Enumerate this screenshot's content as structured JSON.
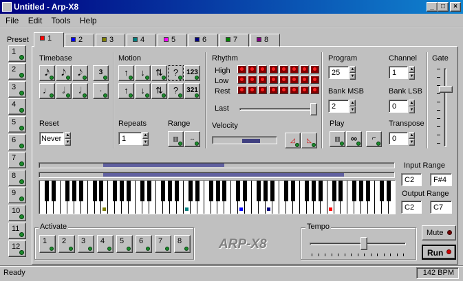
{
  "window": {
    "title": "Untitled - Arp-X8"
  },
  "menu": [
    "File",
    "Edit",
    "Tools",
    "Help"
  ],
  "preset": {
    "label": "Preset",
    "buttons": [
      "1",
      "2",
      "3",
      "4",
      "5",
      "6",
      "7",
      "8",
      "9",
      "10",
      "11",
      "12"
    ]
  },
  "tabs": [
    {
      "label": "1",
      "color": "#ff0000"
    },
    {
      "label": "2",
      "color": "#0000ff"
    },
    {
      "label": "3",
      "color": "#808000"
    },
    {
      "label": "4",
      "color": "#008080"
    },
    {
      "label": "5",
      "color": "#ff00ff"
    },
    {
      "label": "6",
      "color": "#000080"
    },
    {
      "label": "7",
      "color": "#008000"
    },
    {
      "label": "8",
      "color": "#800080"
    }
  ],
  "timebase": {
    "label": "Timebase",
    "b1": "3",
    "b2": "·"
  },
  "motion": {
    "label": "Motion",
    "up": "↑",
    "down": "↓",
    "updown": "⇅",
    "random": "?",
    "order1": "123",
    "order2": "321"
  },
  "reset": {
    "label": "Reset",
    "value": "Never"
  },
  "repeats": {
    "label": "Repeats",
    "value": "1"
  },
  "range": {
    "label": "Range"
  },
  "rhythm": {
    "label": "Rhythm",
    "rows": [
      "High",
      "Low",
      "Rest"
    ],
    "last_label": "Last"
  },
  "velocity": {
    "label": "Velocity",
    "level": 0.45
  },
  "program": {
    "label": "Program",
    "value": "25"
  },
  "channel": {
    "label": "Channel",
    "value": "1"
  },
  "bank_msb": {
    "label": "Bank MSB",
    "value": "2"
  },
  "bank_lsb": {
    "label": "Bank LSB",
    "value": "0"
  },
  "play": {
    "label": "Play",
    "loop": "∞"
  },
  "transpose": {
    "label": "Transpose",
    "value": "0"
  },
  "gate": {
    "label": "Gate"
  },
  "input_range": {
    "label": "Input Range",
    "low": "C2",
    "high": "F#4"
  },
  "output_range": {
    "label": "Output Range",
    "low": "C2",
    "high": "C7"
  },
  "activate": {
    "label": "Activate",
    "buttons": [
      "1",
      "2",
      "3",
      "4",
      "5",
      "6",
      "7",
      "8"
    ]
  },
  "logo": "ARP-X8",
  "tempo": {
    "label": "Tempo"
  },
  "mute_label": "Mute",
  "run_label": "Run",
  "status": {
    "text": "Ready",
    "bpm": "142 BPM"
  }
}
